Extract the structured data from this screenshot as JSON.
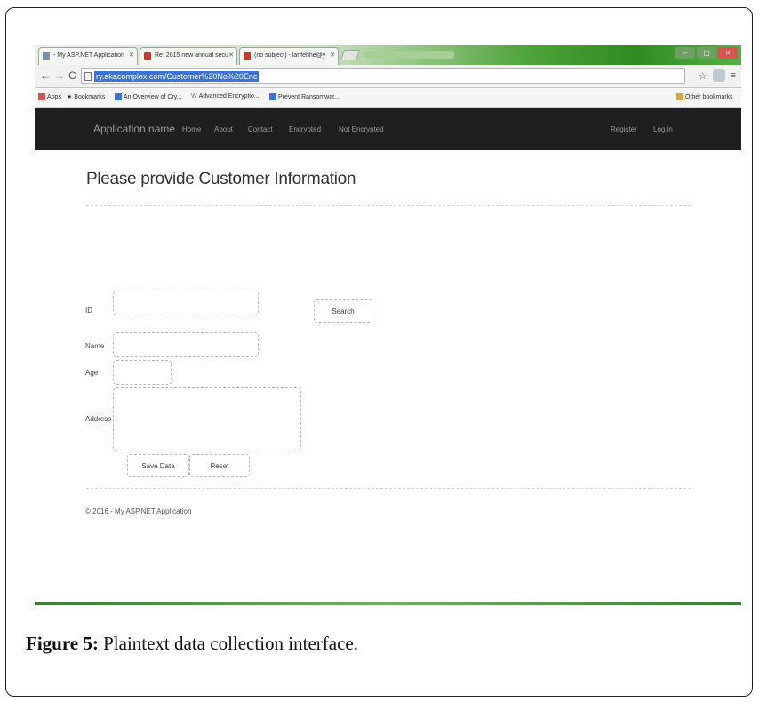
{
  "browser": {
    "tabs": [
      {
        "label": "- My ASP.NET Application",
        "favicon_color": "#7a8fa6"
      },
      {
        "label": "Re: 2015 new annual secu",
        "favicon_color": "#c43d2f"
      },
      {
        "label": "(no subject) - lanfehhe@y",
        "favicon_color": "#c43d2f"
      }
    ],
    "address_url": "ry.akacomplex.com/Customer%20No%20Enc",
    "bookmarks": [
      {
        "label": "Apps",
        "icon": "apps-grid-icon",
        "color": "#d9534f"
      },
      {
        "label": "Bookmarks",
        "icon": "star-icon",
        "color": "#444444"
      },
      {
        "label": "An Overview of Cry...",
        "icon": "page-icon",
        "color": "#3b73d9"
      },
      {
        "label": "Advanced Encryptio...",
        "icon": "w-icon",
        "color": "#777777"
      },
      {
        "label": "Prevent Ransomwar...",
        "icon": "shield-icon",
        "color": "#3b73d9"
      },
      {
        "label": "Other bookmarks",
        "icon": "folder-icon",
        "color": "#e2a13a"
      }
    ]
  },
  "app": {
    "brand": "Application name",
    "nav_links": [
      "Home",
      "About",
      "Contact",
      "Encrypted",
      "Not Encrypted"
    ],
    "nav_right": [
      "Register",
      "Log in"
    ],
    "page_title": "Please provide Customer Information",
    "form": {
      "id_label": "ID",
      "name_label": "Name",
      "age_label": "Age",
      "address_label": "Address",
      "id_value": "",
      "name_value": "",
      "age_value": "",
      "address_value": ""
    },
    "buttons": {
      "search": "Search",
      "save": "Save Data",
      "reset": "Reset"
    },
    "footer": "© 2016 - My ASP.NET Application"
  },
  "caption": {
    "label": "Figure 5:",
    "text": " Plaintext data collection interface."
  },
  "colors": {
    "navbar": "#1f1f1f",
    "url_highlight": "#3b73d9",
    "tabstrip_green": "#2f8b22"
  }
}
